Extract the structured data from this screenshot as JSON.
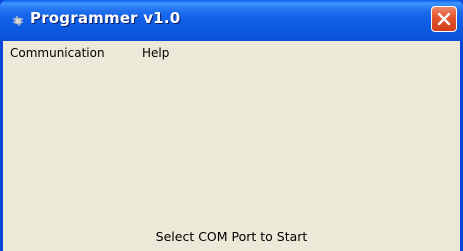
{
  "window": {
    "title": "Programmer v1.0",
    "icon": "app-chip-icon",
    "close_icon": "close-icon"
  },
  "menubar": {
    "items": [
      {
        "label": "Communication"
      },
      {
        "label": "Help"
      }
    ]
  },
  "status": {
    "message": "Select COM Port to Start"
  },
  "colors": {
    "titlebar": "#0a58df",
    "client_background": "#ece9d8",
    "close_button": "#e0502a"
  }
}
